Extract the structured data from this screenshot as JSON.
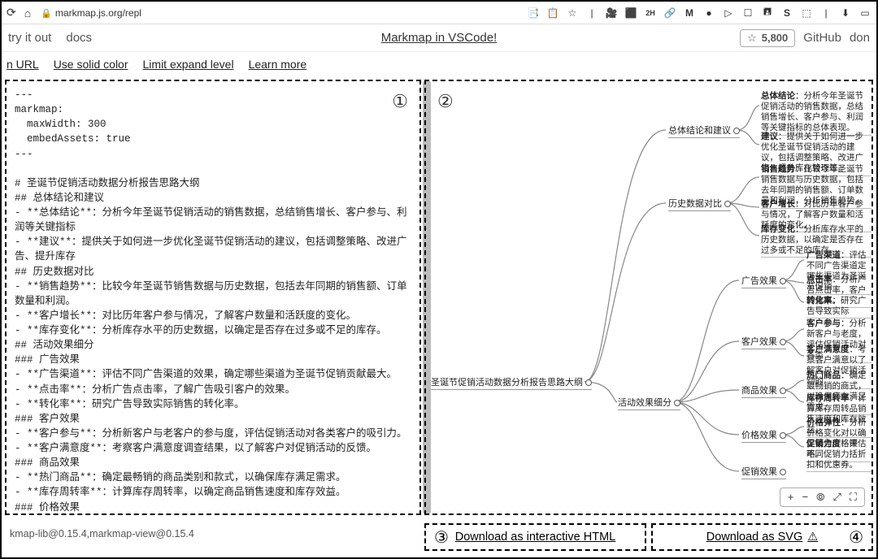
{
  "browser": {
    "url": "markmap.js.org/repl",
    "nav_icons": [
      "reload",
      "home"
    ],
    "ext_icons": [
      "📑",
      "📋",
      "☆",
      "|",
      "🎥",
      "⬛",
      "2H",
      "🔗",
      "M",
      "●",
      "▷",
      "☐",
      "🖪",
      "S",
      "⬚",
      "|",
      "⬇",
      "▭"
    ]
  },
  "header": {
    "try_it_out": "try it out",
    "docs": "docs",
    "center_link": "Markmap in VSCode!",
    "star_count": "5,800",
    "github": "GitHub",
    "donate": "don"
  },
  "toolbar": {
    "open_url": "n URL",
    "use_solid": "Use solid color",
    "limit_expand": "Limit expand level",
    "learn_more": "Learn more"
  },
  "badges": {
    "one": "①",
    "two": "②",
    "three": "③",
    "four": "④"
  },
  "editor_text": "---\nmarkmap:\n  maxWidth: 300\n  embedAssets: true\n---\n\n# 圣诞节促销活动数据分析报告思路大纲\n## 总体结论和建议\n- **总体结论**：分析今年圣诞节促销活动的销售数据，总结销售增长、客户参与、利润等关键指标\n- **建议**：提供关于如何进一步优化圣诞节促销活动的建议，包括调整策略、改进广告、提升库存\n## 历史数据对比\n- **销售趋势**：比较今年圣诞节销售数据与历史数据，包括去年同期的销售额、订单数量和利润。\n- **客户增长**：对比历年客户参与情况，了解客户数量和活跃度的变化。\n- **库存变化**：分析库存水平的历史数据，以确定是否存在过多或不足的库存。\n## 活动效果细分\n### 广告效果\n- **广告渠道**：评估不同广告渠道的效果，确定哪些渠道为圣诞节促销贡献最大。\n- **点击率**：分析广告点击率，了解广告吸引客户的效果。\n- **转化率**：研究广告导致实际销售的转化率。\n### 客户效果\n- **客户参与**：分析新客户与老客户的参与度，评估促销活动对各类客户的吸引力。\n- **客户满意度**：考察客户满意度调查结果，以了解客户对促销活动的反馈。\n### 商品效果\n- **热门商品**：确定最畅销的商品类别和款式，以确保库存满足需求。\n- **库存周转率**：计算库存周转率，以确定商品销售速度和库存效益。\n### 价格效果\n- **价格弹性**：分析价格变化对销售的影响，以确定最佳价格策略。",
  "mindmap": {
    "root": "圣诞节促销活动数据分析报告思路大纲",
    "l1": {
      "a": "总体结论和建议",
      "b": "历史数据对比",
      "c": "活动效果细分"
    },
    "l2": {
      "c1": "广告效果",
      "c2": "客户效果",
      "c3": "商品效果",
      "c4": "价格效果",
      "c5": "促销效果"
    },
    "leaves": {
      "a1": {
        "b": "总体结论",
        "t": "：分析今年圣诞节促销活动的销售数据，总结销售增长、客户参与、利润等关键指标的总体表现。"
      },
      "a2": {
        "b": "建议",
        "t": "：提供关于如何进一步优化圣诞节促销活动的建议，包括调整策略、改进广告、提升库存管理等。"
      },
      "b1": {
        "b": "销售趋势",
        "t": "：比较今年圣诞节销售数据与历史数据，包括去年同期的销售额、订单数量和利润，分析销售趋势。"
      },
      "b2": {
        "b": "客户增长",
        "t": "：对比历年客户参与情况，了解客户数量和活跃度的变化。"
      },
      "b3": {
        "b": "库存变化",
        "t": "：分析库存水平的历史数据，以确定是否存在过多或不足的库存。"
      },
      "c1a": {
        "b": "广告渠道",
        "t": "：评估不同广告渠道定哪些渠道为圣诞节促销"
      },
      "c1b": {
        "b": "点击率",
        "t": "：分析广告点击率，客户的效果。"
      },
      "c1c": {
        "b": "转化率",
        "t": "：研究广告导致实际"
      },
      "c2a": {
        "b": "客户参与",
        "t": "：分析新客户与老度，评估促销活动对各类"
      },
      "c2b": {
        "b": "客户满意度",
        "t": "：考察客户满意以了解客户对促销活动的"
      },
      "c3a": {
        "b": "热门商品",
        "t": "：确定最畅销的商式，以确保库存满足需求。"
      },
      "c3b": {
        "b": "库存周转率",
        "t": "：计算库存周转品销售速度和库存效益。"
      },
      "c4a": {
        "b": "价格弹性",
        "t": "：分析价格变化对以确定最佳价格策略。"
      },
      "c4b": {
        "b": "促销力度",
        "t": "：评估不同促销力括折扣和优惠券。"
      }
    }
  },
  "view_controls": [
    "+",
    "−",
    "⦾",
    "⤢",
    "⛶"
  ],
  "bottom": {
    "version": "kmap-lib@0.15.4,markmap-view@0.15.4",
    "dl_html": "Download as interactive HTML",
    "dl_svg": "Download as SVG",
    "warn": "⚠"
  }
}
